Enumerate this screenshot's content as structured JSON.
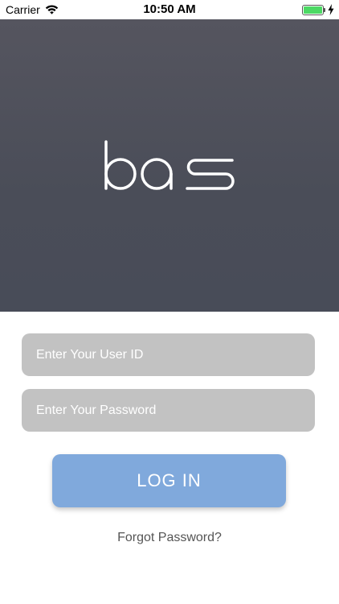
{
  "status_bar": {
    "carrier": "Carrier",
    "time": "10:50 AM",
    "wifi_icon": "wifi-icon",
    "battery_icon": "battery-icon",
    "charging_icon": "lightning-bolt-icon",
    "battery_color": "#4cd964"
  },
  "hero": {
    "logo_text": "bas",
    "background_color": "#4c4e59"
  },
  "login_form": {
    "user_id": {
      "value": "",
      "placeholder": "Enter Your User ID"
    },
    "password": {
      "value": "",
      "placeholder": "Enter Your Password"
    },
    "login_label": "LOG IN",
    "forgot_label": "Forgot Password?",
    "input_color": "#c2c2c2",
    "button_color": "#80a9dc"
  }
}
